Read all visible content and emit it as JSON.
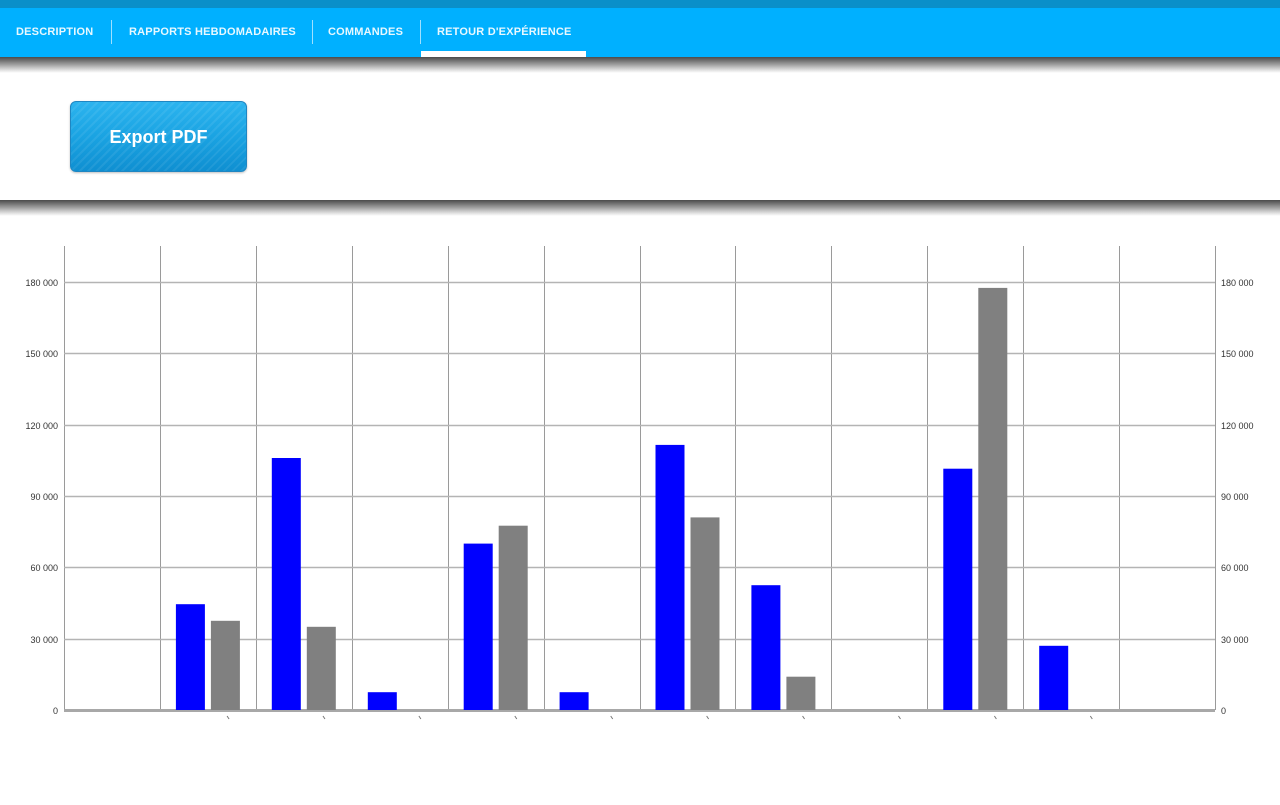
{
  "tabs": [
    {
      "label": "DESCRIPTION",
      "active": false
    },
    {
      "label": "RAPPORTS HEBDOMADAIRES",
      "active": false
    },
    {
      "label": "COMMANDES",
      "active": false
    },
    {
      "label": "RETOUR D'EXPÉRIENCE",
      "active": true
    }
  ],
  "toolbar": {
    "export_label": "Export PDF"
  },
  "colors": {
    "tabbar": "#00b0ff",
    "series_a": "#0000ff",
    "series_b": "#808080"
  },
  "chart_data": {
    "type": "bar",
    "title": "",
    "xlabel": "",
    "ylabel": "",
    "ylim": [
      0,
      195000
    ],
    "yticks": [
      0,
      30000,
      60000,
      90000,
      120000,
      150000,
      180000
    ],
    "ytick_labels": [
      "0",
      "30 000",
      "60 000",
      "90 000",
      "120 000",
      "150 000",
      "180 000"
    ],
    "dual_y_axis": true,
    "grid": true,
    "categories": [
      "",
      "",
      "",
      "",
      "",
      "",
      "",
      "",
      "",
      "",
      "",
      ""
    ],
    "series": [
      {
        "color": "#0000ff",
        "values": [
          0,
          44500,
          106000,
          7500,
          70000,
          7500,
          111500,
          52500,
          0,
          101500,
          27000,
          0
        ]
      },
      {
        "color": "#808080",
        "values": [
          0,
          37500,
          35000,
          0,
          77500,
          0,
          81000,
          14000,
          0,
          177500,
          0,
          0
        ]
      }
    ]
  }
}
